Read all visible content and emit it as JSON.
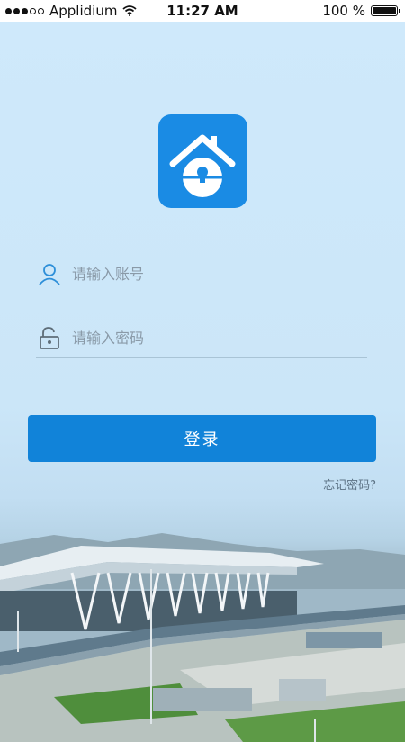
{
  "status_bar": {
    "carrier": "Applidium",
    "time": "11:27 AM",
    "battery": "100 %",
    "signal_icon": "signal-dots-icon",
    "wifi_icon": "wifi-icon",
    "battery_icon": "battery-icon"
  },
  "logo": {
    "icon": "house-lock-icon",
    "color": "#1a8be4"
  },
  "account": {
    "placeholder": "请输入账号",
    "value": "",
    "icon": "user-icon"
  },
  "password": {
    "placeholder": "请输入密码",
    "value": "",
    "icon": "unlock-icon"
  },
  "login_button": {
    "label": "登录",
    "color": "#1183d9"
  },
  "forgot_password": "忘记密码?",
  "background": {
    "description_icon": "airport-terminal-image"
  }
}
